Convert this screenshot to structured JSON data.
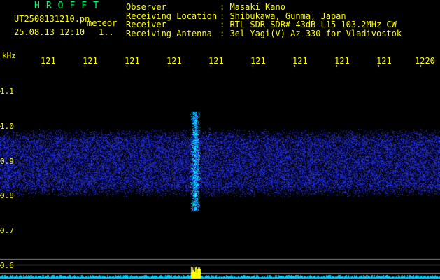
{
  "header": {
    "brand": "HROFFT",
    "filename": "UT2508131210.pn",
    "meteor_label": "meteor",
    "timestamp": "25.08.13 12:10",
    "timestamp_extra": "1.."
  },
  "info": {
    "labels": [
      "Observer",
      "Receiving Location",
      "Receiver",
      "Receiving Antenna"
    ],
    "values": [
      ": Masaki Kano",
      ": Shibukawa, Gunma, Japan",
      ": RTL-SDR SDR# 43dB L15 103.2MHz CW",
      ": 3el Yagi(V) Az 330 for Vladivostok"
    ]
  },
  "axis": {
    "y_unit": "kHz",
    "y_ticks": [
      "1.1",
      "1.0",
      "0.9",
      "0.8",
      "0.7",
      "0.6"
    ],
    "time_ticks": [
      "121",
      "121",
      "121",
      "121",
      "121",
      "121",
      "121",
      "121",
      "121",
      "1220"
    ]
  },
  "colors": {
    "label_text": "#ffff00",
    "brand_text": "#00ff66",
    "background": "#000000",
    "noise": "#1a2aff",
    "meteor_core": "#00ffff",
    "spectrum": "#00ccff",
    "spectrum_peak": "#ffff00"
  }
}
